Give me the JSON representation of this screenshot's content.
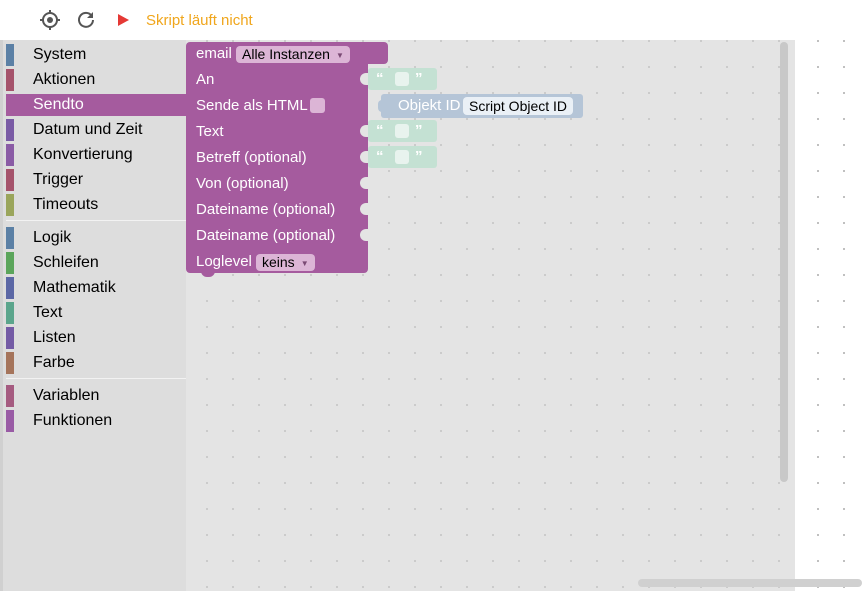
{
  "toolbar": {
    "target_icon": "crosshair-icon",
    "refresh_icon": "refresh-icon",
    "run_icon": "play-icon",
    "status_text": "Skript läuft nicht",
    "status_color": "#f0a61c",
    "run_color": "#e53935"
  },
  "toolbox": {
    "categories": [
      {
        "label": "System",
        "color": "#5b80a5"
      },
      {
        "label": "Aktionen",
        "color": "#a5536b"
      },
      {
        "label": "Sendto",
        "color": "#a55b9e",
        "selected": true
      },
      {
        "label": "Datum und Zeit",
        "color": "#7a5ba5"
      },
      {
        "label": "Konvertierung",
        "color": "#8a5ba5"
      },
      {
        "label": "Trigger",
        "color": "#a5536b"
      },
      {
        "label": "Timeouts",
        "color": "#9aa55b"
      },
      {
        "label": "Logik",
        "color": "#5b80a5"
      },
      {
        "label": "Schleifen",
        "color": "#5ba55b"
      },
      {
        "label": "Mathematik",
        "color": "#5b67a5"
      },
      {
        "label": "Text",
        "color": "#5ba58c"
      },
      {
        "label": "Listen",
        "color": "#745ba5"
      },
      {
        "label": "Farbe",
        "color": "#a5745b"
      },
      {
        "label": "Variablen",
        "color": "#a55b80"
      },
      {
        "label": "Funktionen",
        "color": "#995ba5"
      }
    ]
  },
  "block": {
    "email_label": "email",
    "instance_value": "Alle Instanzen",
    "an_label": "An",
    "html_label": "Sende als HTML",
    "text_label": "Text",
    "subject_label": "Betreff (optional)",
    "from_label": "Von (optional)",
    "file1_label": "Dateiname (optional)",
    "file2_label": "Dateiname (optional)",
    "loglevel_label": "Loglevel",
    "loglevel_value": "keins",
    "color": "#a55b9e"
  },
  "text_block": {
    "open_quote": "“",
    "close_quote": "”"
  },
  "object_block": {
    "label": "Objekt ID",
    "value": "Script Object ID"
  }
}
